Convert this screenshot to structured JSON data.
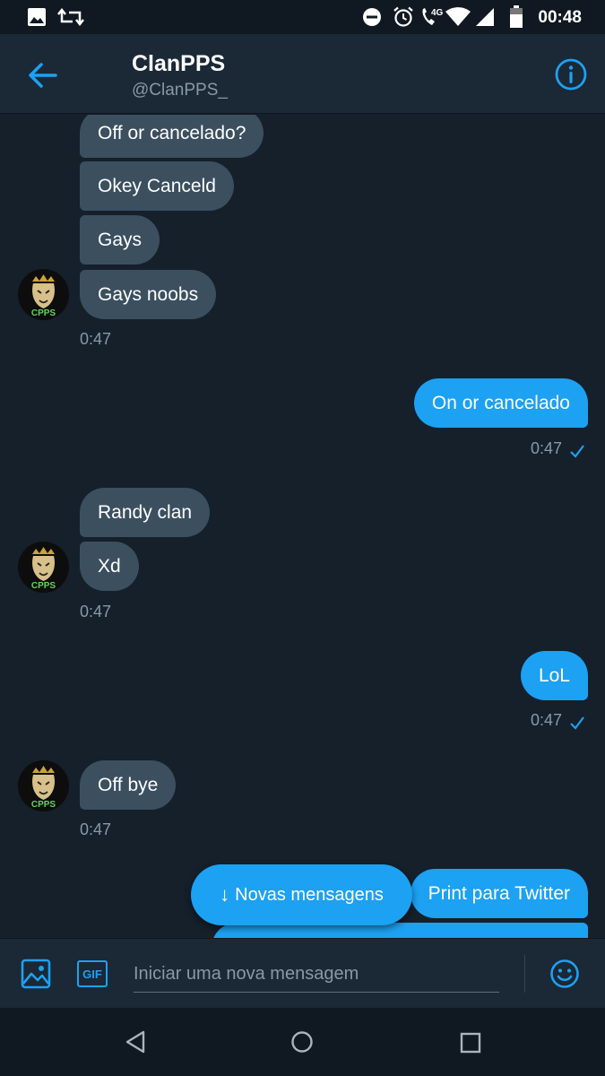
{
  "status_bar": {
    "time": "00:48",
    "network_label": "4G",
    "icons": [
      "image-icon",
      "retweet-icon",
      "do-not-disturb-icon",
      "alarm-icon",
      "wifi-call-icon",
      "wifi-icon",
      "signal-icon",
      "battery-icon"
    ]
  },
  "header": {
    "name": "ClanPPS",
    "handle": "@ClanPPS_",
    "back_icon": "arrow-left-icon",
    "info_icon": "info-icon"
  },
  "messages": [
    {
      "side": "received",
      "text": "Off or cancelado?"
    },
    {
      "side": "received",
      "text": "Okey Canceld"
    },
    {
      "side": "received",
      "text": "Gays"
    },
    {
      "side": "received",
      "text": "Gays noobs"
    },
    {
      "side": "timestamp",
      "text": "0:47"
    },
    {
      "side": "sent",
      "text": "On or cancelado"
    },
    {
      "side": "timestamp",
      "text": "0:47"
    },
    {
      "side": "received",
      "text": "Randy clan"
    },
    {
      "side": "received",
      "text": "Xd"
    },
    {
      "side": "timestamp",
      "text": "0:47"
    },
    {
      "side": "sent",
      "text": "LoL"
    },
    {
      "side": "timestamp",
      "text": "0:47"
    },
    {
      "side": "received",
      "text": "Off bye"
    },
    {
      "side": "timestamp",
      "text": "0:47"
    },
    {
      "side": "sent",
      "text": "Print para Twitter"
    }
  ],
  "new_messages_button": {
    "label": "Novas mensagens"
  },
  "composer": {
    "placeholder": "Iniciar uma nova mensagem",
    "gif_label": "GIF"
  },
  "avatar": {
    "label": "CPPS"
  },
  "colors": {
    "background": "#15202b",
    "header": "#1b2836",
    "received_bubble": "#3b4f5f",
    "sent_bubble": "#1da1f2",
    "accent": "#1da1f2",
    "muted_text": "#8899a6"
  }
}
